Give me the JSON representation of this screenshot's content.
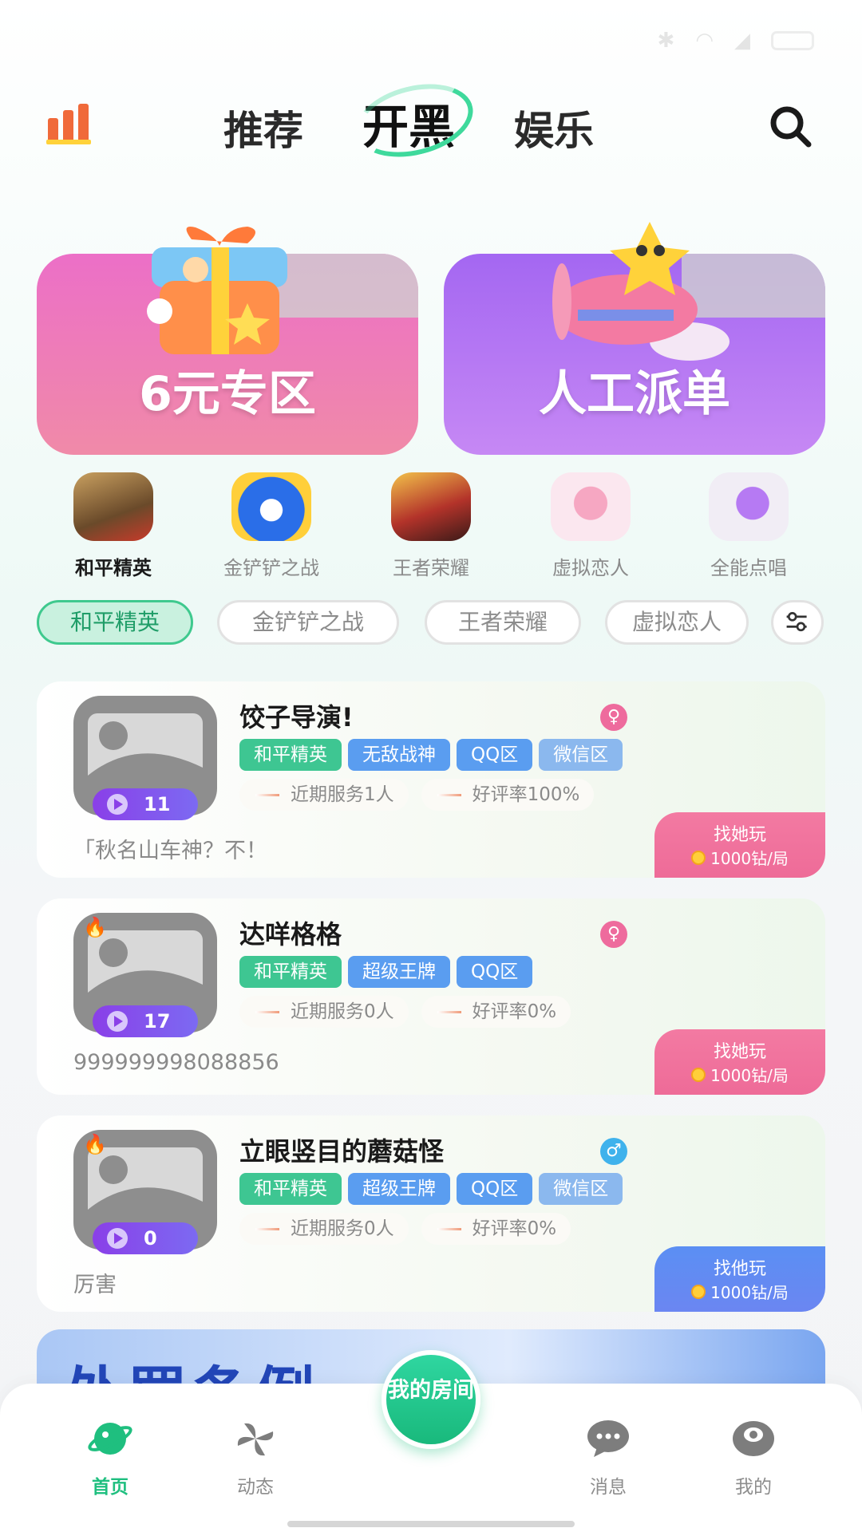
{
  "header": {
    "tabs": [
      "推荐",
      "开黑",
      "娱乐"
    ],
    "active_tab": "开黑"
  },
  "banners": {
    "left": "6元专区",
    "right": "人工派单"
  },
  "games": [
    "和平精英",
    "金铲铲之战",
    "王者荣耀",
    "虚拟恋人",
    "全能点唱"
  ],
  "chips": [
    "和平精英",
    "金铲铲之战",
    "王者荣耀",
    "虚拟恋人"
  ],
  "cards": [
    {
      "name": "饺子导演!",
      "gender": "♀",
      "plays": "11",
      "tags": [
        "和平精英",
        "无敌战神",
        "QQ区",
        "微信区"
      ],
      "served": "近期服务1人",
      "rating": "好评率100%",
      "bio": "「秋名山车神？不！",
      "cta": "找她玩",
      "price": "1000钻/局"
    },
    {
      "name": "达咩格格",
      "gender": "♀",
      "plays": "17",
      "tags": [
        "和平精英",
        "超级王牌",
        "QQ区"
      ],
      "served": "近期服务0人",
      "rating": "好评率0%",
      "bio": "999999998088856",
      "cta": "找她玩",
      "price": "1000钻/局"
    },
    {
      "name": "立眼竖目的蘑菇怪",
      "gender": "♂",
      "plays": "0",
      "tags": [
        "和平精英",
        "超级王牌",
        "QQ区",
        "微信区"
      ],
      "served": "近期服务0人",
      "rating": "好评率0%",
      "bio": "厉害",
      "cta": "找他玩",
      "price": "1000钻/局"
    }
  ],
  "promo_text": "处罚条例",
  "bottom_nav": {
    "home": "首页",
    "feed": "动态",
    "room": "我的房间",
    "messages": "消息",
    "mine": "我的"
  },
  "colors": {
    "accent_green": "#1fbf7f",
    "female_pink": "#ee6b98",
    "male_blue": "#5b8ff3"
  }
}
